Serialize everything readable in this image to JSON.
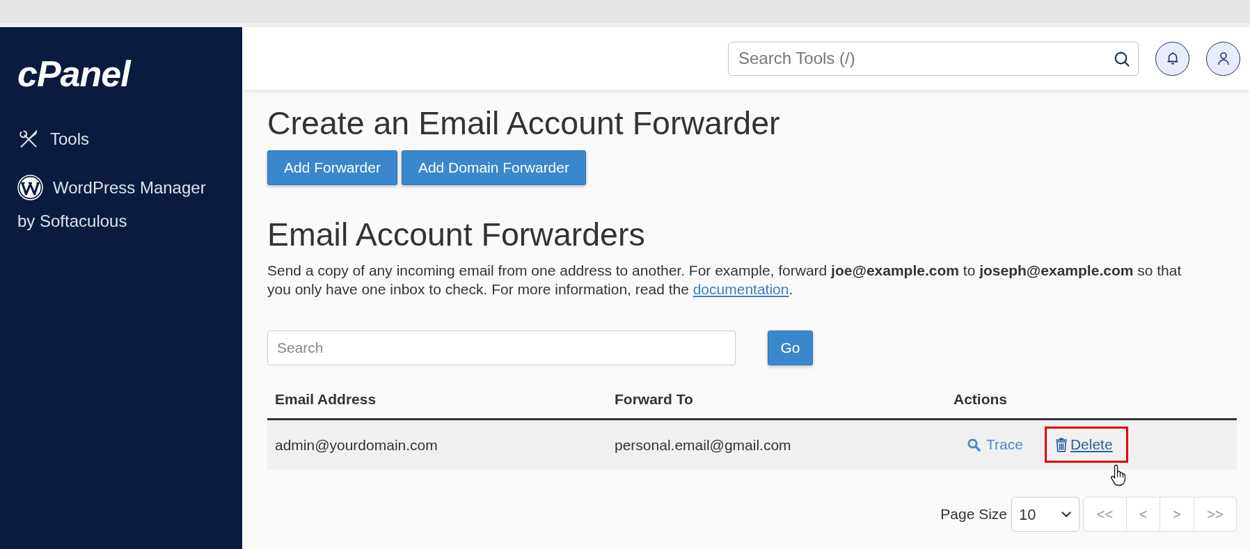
{
  "sidebar": {
    "logo": "cPanel",
    "items": [
      {
        "kind": "tools",
        "label": "Tools"
      },
      {
        "kind": "wordpress",
        "label": "WordPress Manager by Softaculous"
      }
    ]
  },
  "header": {
    "search": {
      "placeholder": "Search Tools (/)"
    }
  },
  "create_section": {
    "title": "Create an Email Account Forwarder",
    "buttons": [
      "Add Forwarder",
      "Add Domain Forwarder"
    ]
  },
  "forwarders_section": {
    "title": "Email Account Forwarders",
    "description": {
      "text": "Send a copy of any incoming email from one address to another. For example, forward **joe@example.com** to **joseph@example.com** so that you only have one inbox to check. For more information, read the",
      "link": "documentation",
      "end": "."
    },
    "search": {
      "placeholder": "Search",
      "button": "Go"
    }
  },
  "table": {
    "columns": [
      "Email Address",
      "Forward To",
      "Actions"
    ],
    "rows": [
      {
        "email_address": "admin@yourdomain.com",
        "forward_to": "personal.email@gmail.com",
        "actions": [
          {
            "kind": "trace",
            "label": "Trace",
            "hovered": false,
            "highlighted": false
          },
          {
            "kind": "delete",
            "label": "Delete",
            "hovered": true,
            "highlighted": true
          }
        ]
      }
    ]
  },
  "pagination": {
    "page_size_label": "Page Size",
    "page_size": "10",
    "buttons": [
      {
        "label": "<<",
        "disabled": true
      },
      {
        "label": "<",
        "disabled": true
      },
      {
        "label": ">",
        "disabled": true
      },
      {
        "label": ">>",
        "disabled": true
      }
    ]
  }
}
